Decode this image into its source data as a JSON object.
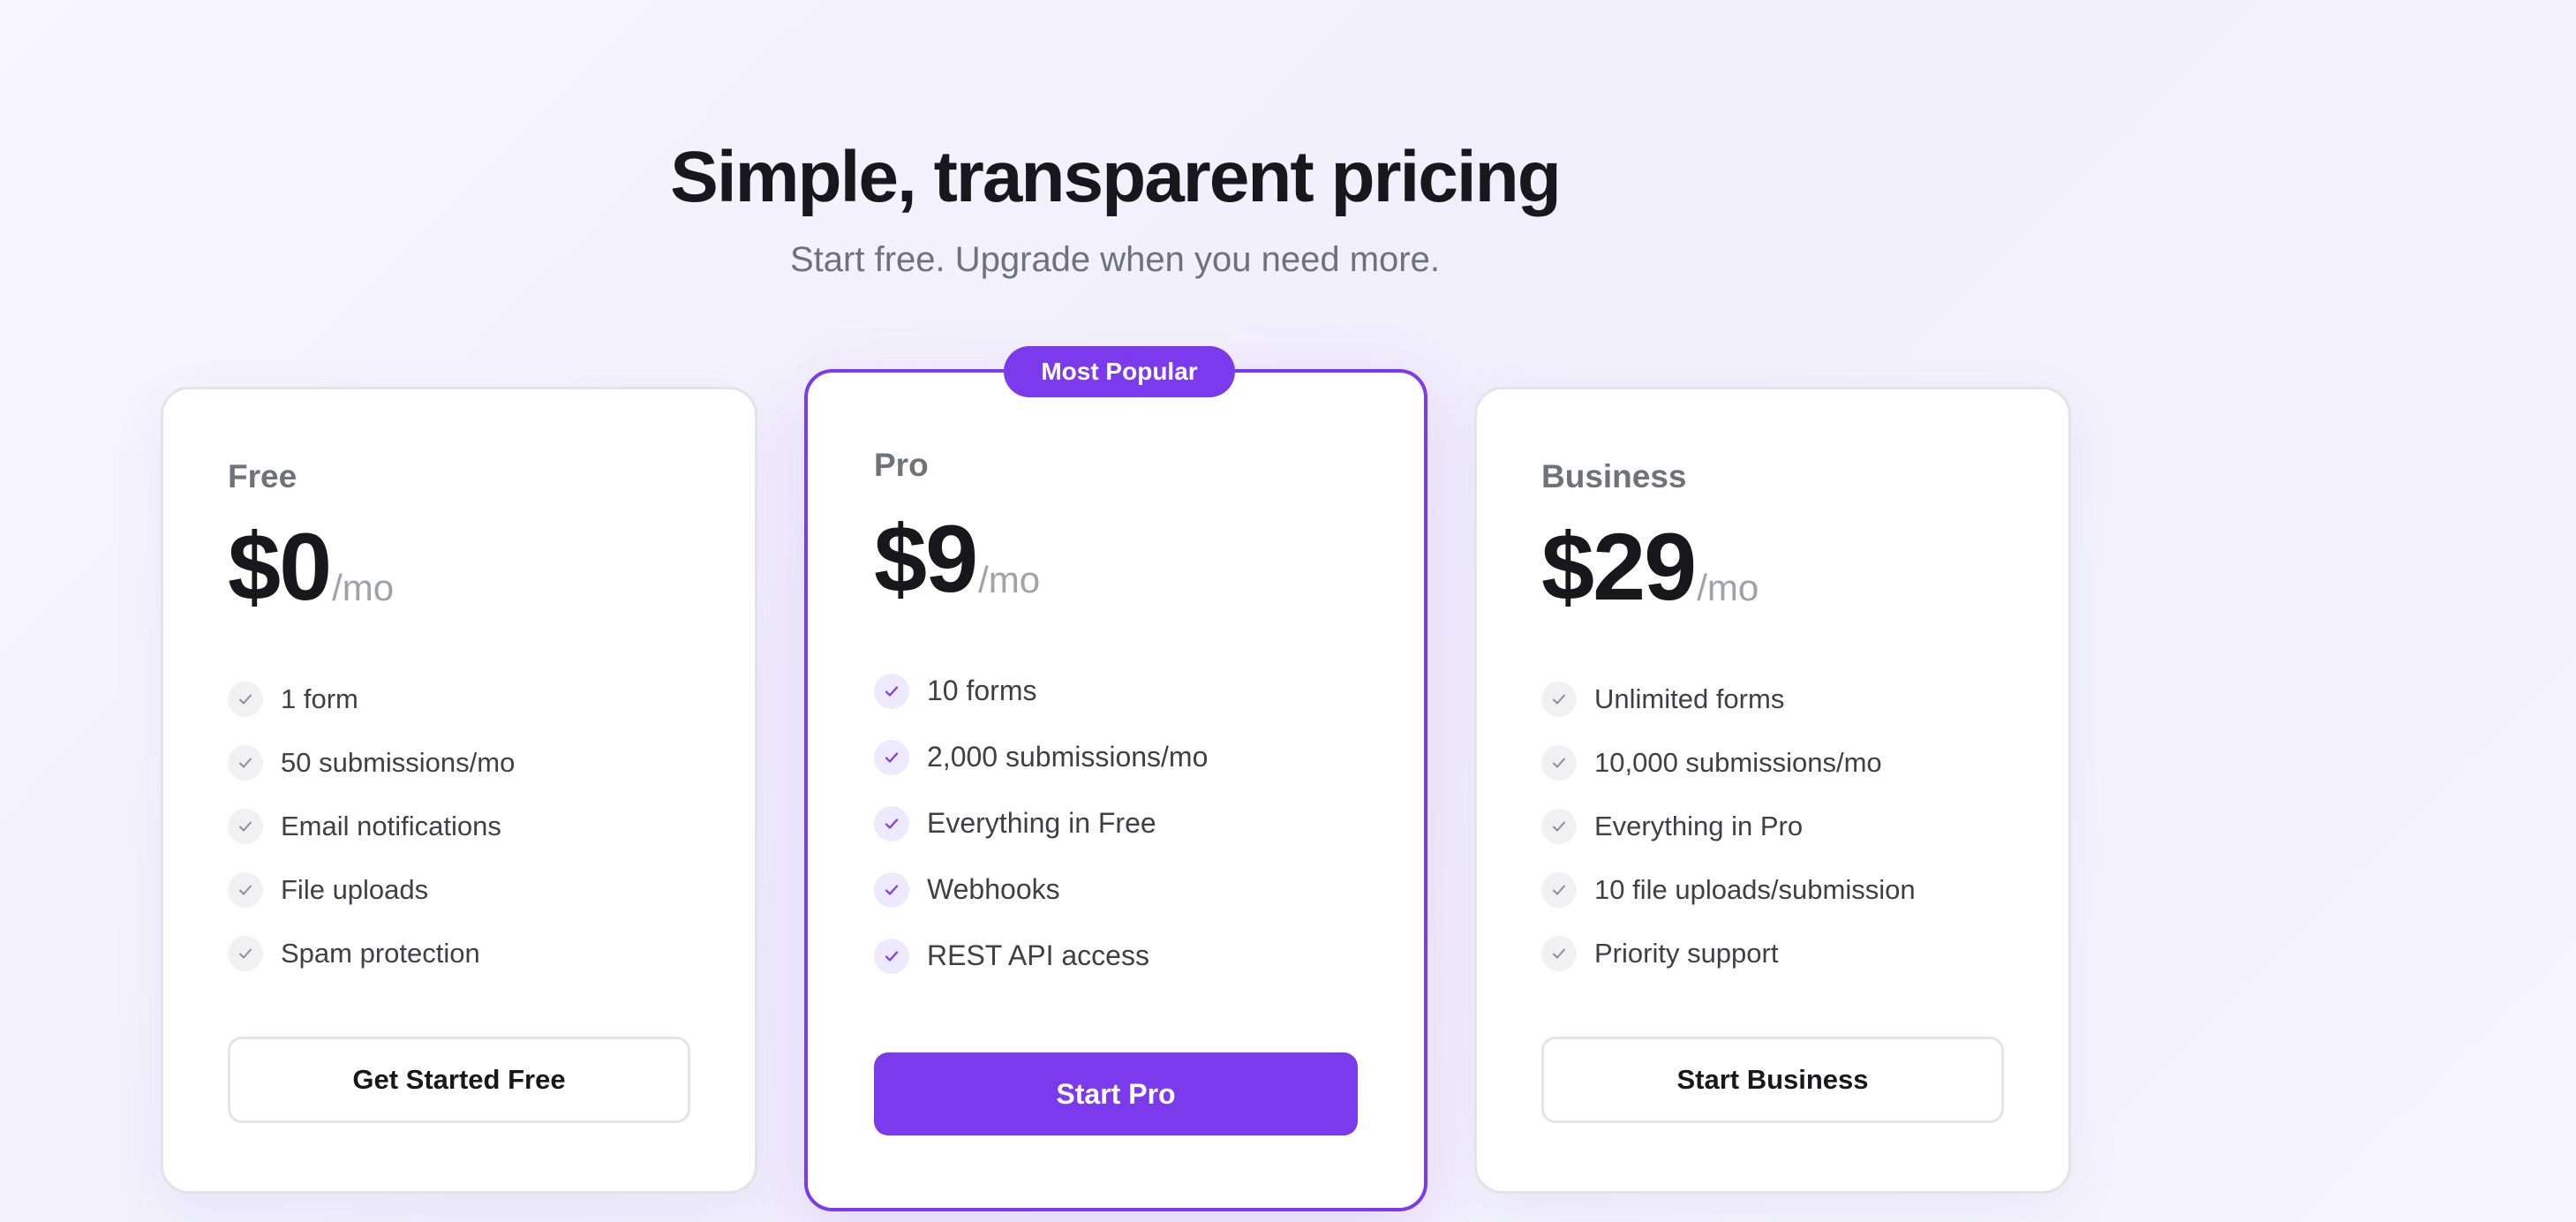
{
  "header": {
    "title": "Simple, transparent pricing",
    "subtitle": "Start free. Upgrade when you need more."
  },
  "colors": {
    "accent": "#7c3aed",
    "background": "#f3f1fc",
    "card": "#ffffff",
    "text_primary": "#17171c",
    "text_muted": "#71717a"
  },
  "plans": [
    {
      "name": "Free",
      "price": "$0",
      "period": "/mo",
      "features": [
        "1 form",
        "50 submissions/mo",
        "Email notifications",
        "File uploads",
        "Spam protection"
      ],
      "cta": "Get Started Free"
    },
    {
      "name": "Pro",
      "badge": "Most Popular",
      "price": "$9",
      "period": "/mo",
      "features": [
        "10 forms",
        "2,000 submissions/mo",
        "Everything in Free",
        "Webhooks",
        "REST API access"
      ],
      "cta": "Start Pro"
    },
    {
      "name": "Business",
      "price": "$29",
      "period": "/mo",
      "features": [
        "Unlimited forms",
        "10,000 submissions/mo",
        "Everything in Pro",
        "10 file uploads/submission",
        "Priority support"
      ],
      "cta": "Start Business"
    }
  ],
  "icons": {
    "feature_check": "check-icon"
  }
}
